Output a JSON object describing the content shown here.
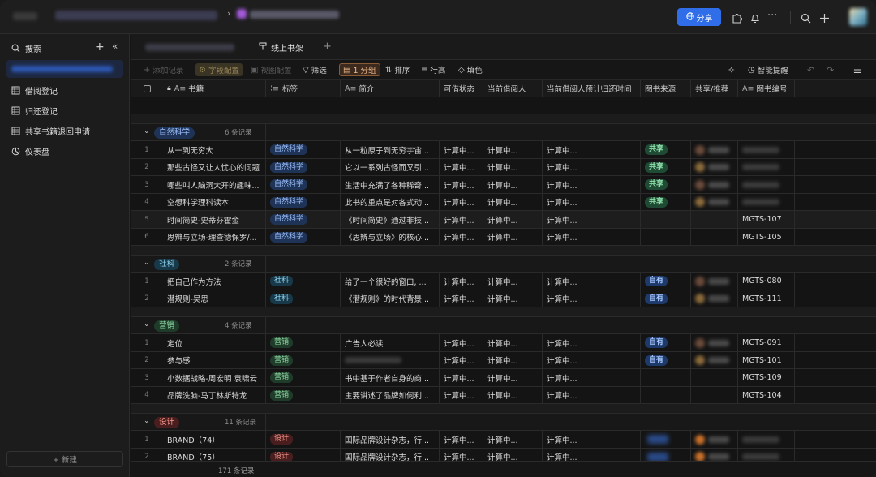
{
  "colors": {
    "accent": "#2f6ee8",
    "natural_tag_bg": "#1e3356",
    "natural_tag_fg": "#9ec1ff",
    "social_tag_bg": "#17394a",
    "social_tag_fg": "#8fd3ee",
    "marketing_tag_bg": "#1f3b2a",
    "marketing_tag_fg": "#8ed7a2",
    "design_tag_bg": "#4a1e1e",
    "design_tag_fg": "#ff9c8f",
    "share_bg": "#1f4a33",
    "share_fg": "#8fe0ab",
    "own_bg": "#1e3a6a",
    "own_fg": "#a8c8ff"
  },
  "topbar": {
    "share_label": "分享",
    "share_icon": "globe-icon",
    "icons": [
      "plugin-icon",
      "bell-icon",
      "more-icon",
      "search-icon",
      "plus-icon"
    ]
  },
  "sidebar": {
    "search_label": "搜索",
    "new_label": "+ 新建",
    "items": [
      {
        "label": "借阅登记",
        "icon": "grid-icon"
      },
      {
        "label": "归还登记",
        "icon": "grid-icon"
      },
      {
        "label": "共享书籍退回申请",
        "icon": "grid-icon"
      },
      {
        "label": "仪表盘",
        "icon": "dashboard-icon"
      }
    ]
  },
  "tabs": {
    "active": "线上书架"
  },
  "toolbar": {
    "add_record": "添加记录",
    "field_config": "字段配置",
    "view_config": "视图配置",
    "filter": "筛选",
    "group": "1 分组",
    "sort": "排序",
    "row_height": "行高",
    "fill": "填色",
    "smart_remind": "智能提醒"
  },
  "columns": [
    "书籍",
    "标签",
    "简介",
    "可借状态",
    "当前借阅人",
    "当前借阅人预计归还时间",
    "图书来源",
    "共享/推荐",
    "图书编号"
  ],
  "groups": [
    {
      "label": "自然科学",
      "count": "6 条记录",
      "tag": "natural",
      "rows": [
        {
          "n": "1",
          "title": "从一到无穷大",
          "tag": "自然科学",
          "intro": "从一粒原子到无穷宇宙...",
          "status": "计算中...",
          "borrower": "计算中...",
          "due": "计算中...",
          "source": "共享",
          "code": ""
        },
        {
          "n": "2",
          "title": "那些古怪又让人忧心的问题",
          "tag": "自然科学",
          "intro": "它以一系列古怪而又引...",
          "status": "计算中...",
          "borrower": "计算中...",
          "due": "计算中...",
          "source": "共享",
          "code": ""
        },
        {
          "n": "3",
          "title": "哪些叫人脑洞大开的趣味...",
          "tag": "自然科学",
          "intro": "生活中充满了各种稀奇...",
          "status": "计算中...",
          "borrower": "计算中...",
          "due": "计算中...",
          "source": "共享",
          "code": ""
        },
        {
          "n": "4",
          "title": "空想科学理科读本",
          "tag": "自然科学",
          "intro": "此书的重点是对各式动...",
          "status": "计算中...",
          "borrower": "计算中...",
          "due": "计算中...",
          "source": "共享",
          "code": ""
        },
        {
          "n": "5",
          "title": "时间简史-史蒂芬霍金",
          "tag": "自然科学",
          "intro": "《时间简史》通过非技...",
          "status": "计算中...",
          "borrower": "计算中...",
          "due": "计算中...",
          "source": "",
          "code": "MGTS-107"
        },
        {
          "n": "6",
          "title": "思辨与立场-理查德保罗/...",
          "tag": "自然科学",
          "intro": "《思辨与立场》的核心...",
          "status": "计算中...",
          "borrower": "计算中...",
          "due": "计算中...",
          "source": "",
          "code": "MGTS-105"
        }
      ]
    },
    {
      "label": "社科",
      "count": "2 条记录",
      "tag": "social",
      "rows": [
        {
          "n": "1",
          "title": "把自己作为方法",
          "tag": "社科",
          "intro": "给了一个很好的窗口, ...",
          "status": "计算中...",
          "borrower": "计算中...",
          "due": "计算中...",
          "source": "自有",
          "code": "MGTS-080"
        },
        {
          "n": "2",
          "title": "潜规则-吴思",
          "tag": "社科",
          "intro": "《潜规则》的时代背景...",
          "status": "计算中...",
          "borrower": "计算中...",
          "due": "计算中...",
          "source": "自有",
          "code": "MGTS-111"
        }
      ]
    },
    {
      "label": "营销",
      "count": "4 条记录",
      "tag": "marketing",
      "rows": [
        {
          "n": "1",
          "title": "定位",
          "tag": "营销",
          "intro": "广告人必读",
          "status": "计算中...",
          "borrower": "计算中...",
          "due": "计算中...",
          "source": "自有",
          "code": "MGTS-091"
        },
        {
          "n": "2",
          "title": "参与感",
          "tag": "营销",
          "intro": "",
          "status": "计算中...",
          "borrower": "计算中...",
          "due": "计算中...",
          "source": "自有",
          "code": "MGTS-101"
        },
        {
          "n": "3",
          "title": "小数据战略-周宏明 袁啸云",
          "tag": "营销",
          "intro": "书中基于作者自身的商...",
          "status": "计算中...",
          "borrower": "计算中...",
          "due": "计算中...",
          "source": "",
          "code": "MGTS-109"
        },
        {
          "n": "4",
          "title": "品牌洗脑-马丁林斯特龙",
          "tag": "营销",
          "intro": "主要讲述了品牌如何利...",
          "status": "计算中...",
          "borrower": "计算中...",
          "due": "计算中...",
          "source": "",
          "code": "MGTS-104"
        }
      ]
    },
    {
      "label": "设计",
      "count": "11 条记录",
      "tag": "design",
      "rows": [
        {
          "n": "1",
          "title": "BRAND（74）",
          "tag": "设计",
          "intro": "国际品牌设计杂志，行...",
          "status": "计算中...",
          "borrower": "计算中...",
          "due": "计算中...",
          "source": "",
          "code": ""
        },
        {
          "n": "2",
          "title": "BRAND（75）",
          "tag": "设计",
          "intro": "国际品牌设计杂志，行...",
          "status": "计算中...",
          "borrower": "计算中...",
          "due": "计算中...",
          "source": "",
          "code": ""
        }
      ]
    }
  ],
  "footer": {
    "total": "171 条记录"
  }
}
